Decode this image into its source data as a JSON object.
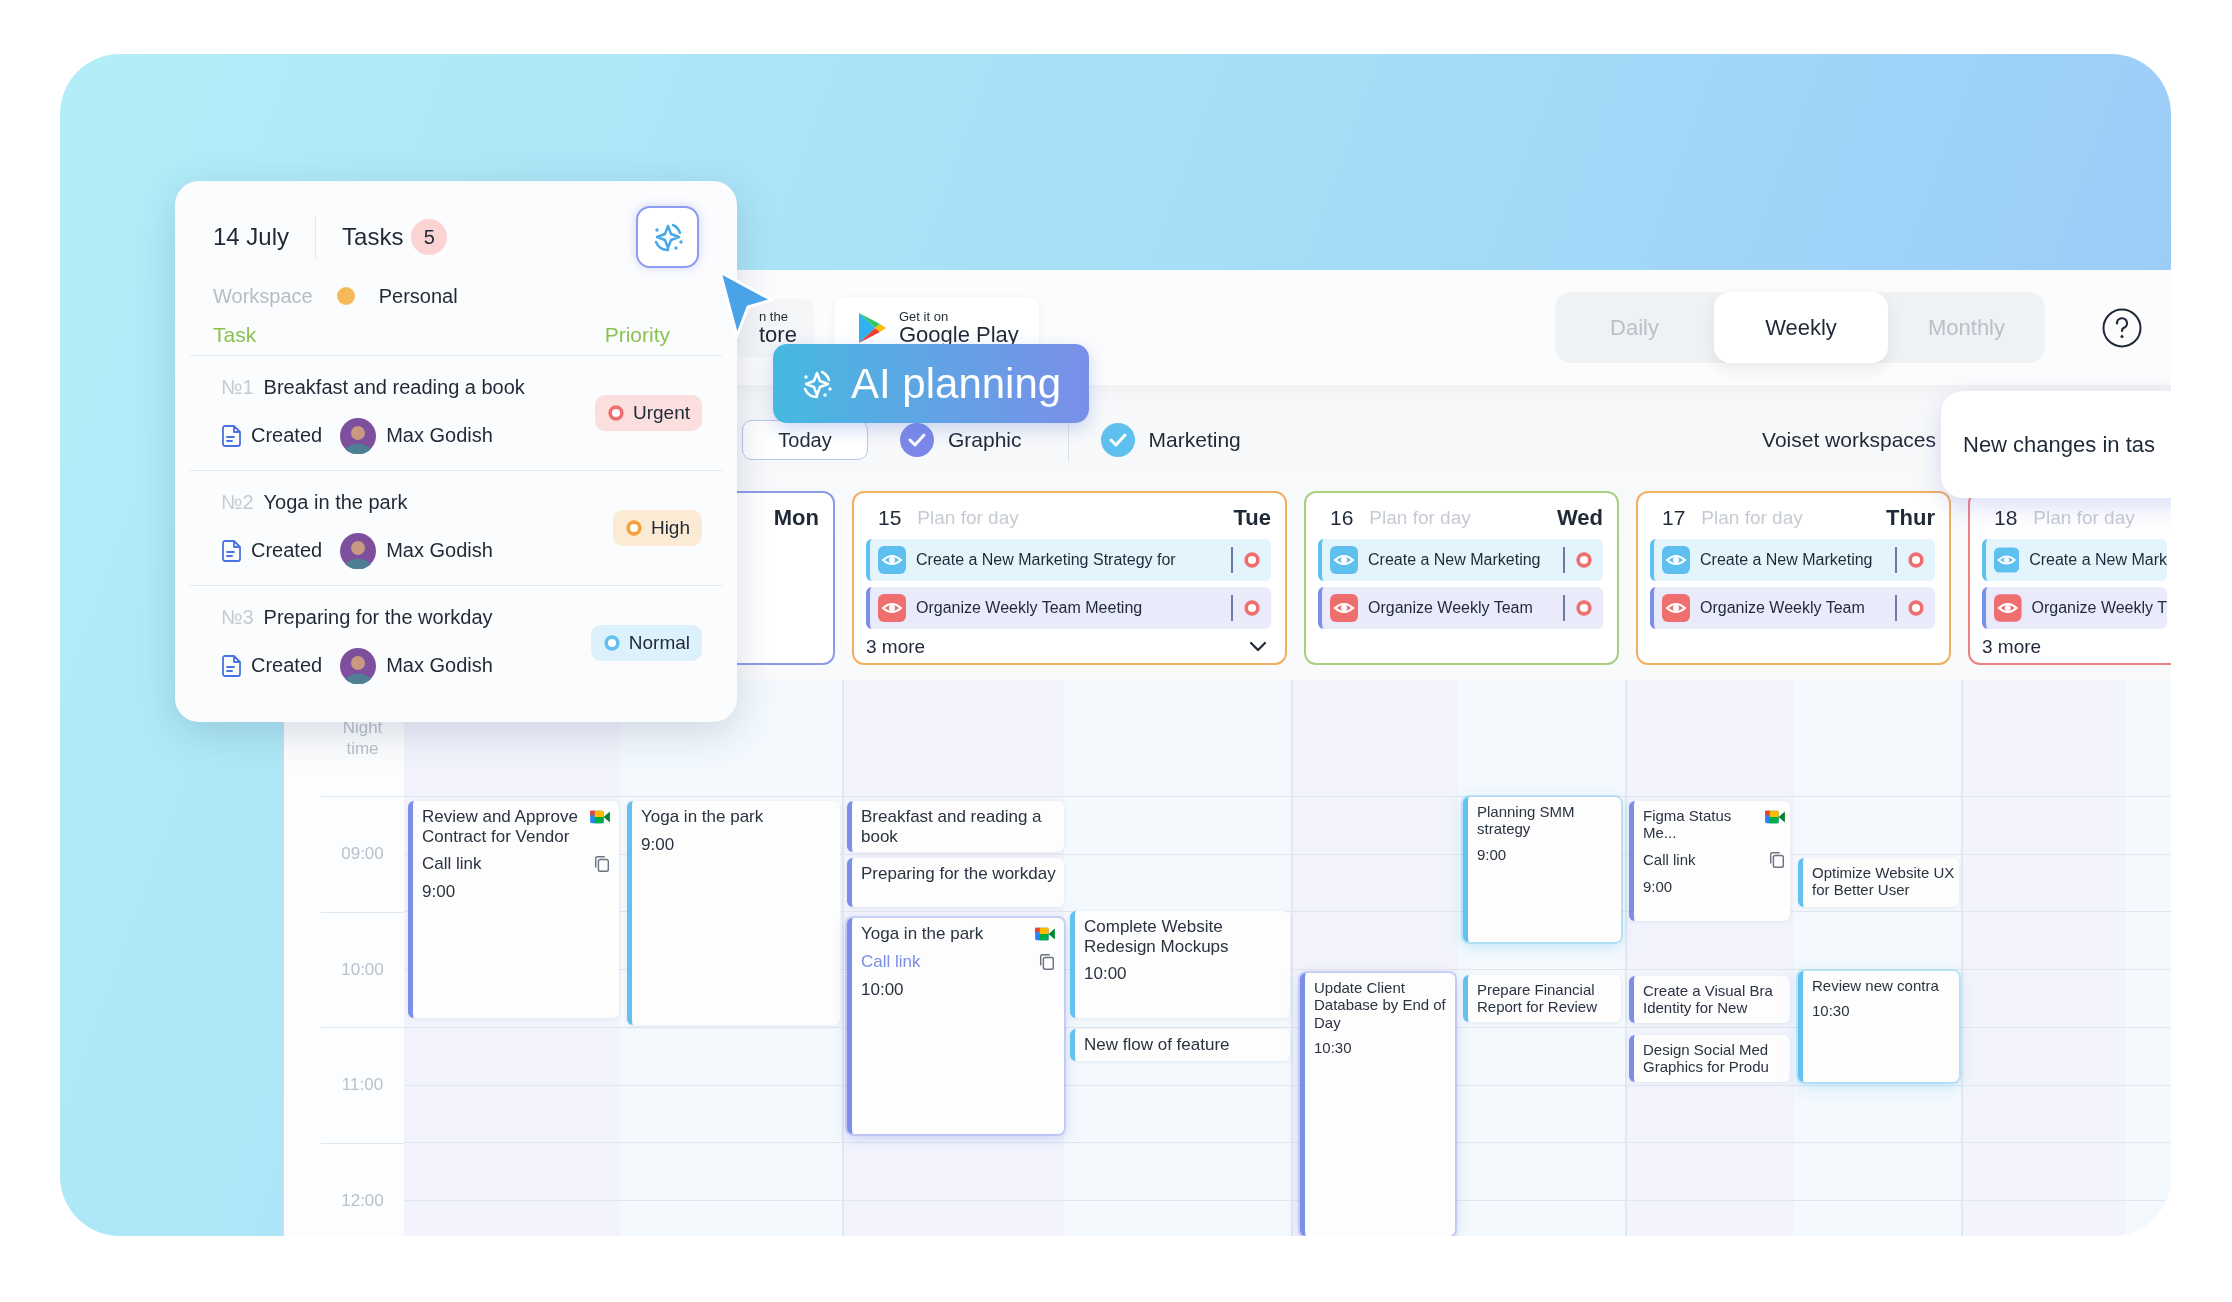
{
  "task_popup": {
    "date": "14 July",
    "tasks_label": "Tasks",
    "task_count": "5",
    "workspace_label": "Workspace",
    "workspace": {
      "name": "Personal",
      "color": "#f5b95a"
    },
    "columns": [
      "Task",
      "Priority"
    ],
    "tasks": [
      {
        "number": "№1",
        "title": "Breakfast and reading a book",
        "status": "Created",
        "assignee": "Max Godish",
        "priority": {
          "label": "Urgent",
          "color": "#ee6f6f"
        }
      },
      {
        "number": "№2",
        "title": "Yoga in the park",
        "status": "Created",
        "assignee": "Max Godish",
        "priority": {
          "label": "High",
          "color": "#f3a23c"
        }
      },
      {
        "number": "№3",
        "title": "Preparing for the workday",
        "status": "Created",
        "assignee": "Max Godish",
        "priority": {
          "label": "Normal",
          "color": "#62c1ee"
        }
      }
    ]
  },
  "top_bar": {
    "store_badges": [
      {
        "kind": "text",
        "line_1": "n the",
        "line_2": "tore"
      },
      {
        "kind": "google_play",
        "line_1": "Get it on",
        "line_2": "Google Play"
      }
    ],
    "views": [
      {
        "label": "Daily",
        "selected": false
      },
      {
        "label": "Weekly",
        "selected": true
      },
      {
        "label": "Monthly",
        "selected": false
      }
    ]
  },
  "ai_banner": {
    "label": "AI planning"
  },
  "filters": {
    "today": "Today",
    "workspaces": [
      {
        "label": "Graphic",
        "checked": true,
        "color": "#7b88e8"
      },
      {
        "label": "Marketing",
        "checked": true,
        "color": "#5ec0ef"
      }
    ],
    "workspaces_label": "Voiset workspaces"
  },
  "notification": {
    "text": "New changes in tas"
  },
  "days": [
    {
      "day": "Mon",
      "color": "#8c9be8"
    },
    {
      "number": "15",
      "plan_label": "Plan for day",
      "day": "Tue",
      "color": "#f0b060",
      "tasks": [
        {
          "title": "Create a New Marketing Strategy for",
          "kind": "info",
          "flagged": true
        },
        {
          "title": "Organize Weekly Team Meeting",
          "kind": "alert",
          "flagged": true
        }
      ],
      "more": "3 more",
      "expandable": true
    },
    {
      "number": "16",
      "plan_label": "Plan for day",
      "day": "Wed",
      "color": "#a8d080",
      "tasks": [
        {
          "title": "Create a New Marketing",
          "kind": "info",
          "flagged": true
        },
        {
          "title": "Organize Weekly Team",
          "kind": "alert",
          "flagged": true
        }
      ]
    },
    {
      "number": "17",
      "plan_label": "Plan for day",
      "day": "Thur",
      "color": "#f0b060",
      "tasks": [
        {
          "title": "Create a New Marketing",
          "kind": "info",
          "flagged": true
        },
        {
          "title": "Organize Weekly Team",
          "kind": "alert",
          "flagged": true
        }
      ]
    },
    {
      "number": "18",
      "plan_label": "Plan for day",
      "color": "#f08080",
      "tasks": [
        {
          "title": "Create a New Mark",
          "kind": "info",
          "flagged": false
        },
        {
          "title": "Organize Weekly T",
          "kind": "alert",
          "flagged": false
        }
      ],
      "more": "3 more",
      "expandable": false
    }
  ],
  "calendar": {
    "times": [
      "Night time",
      "09:00",
      "10:00",
      "11:00",
      "12:00"
    ],
    "events": [
      {
        "title": "Review and Approve Contract for Vendor",
        "meet": true,
        "call_link": "Call link",
        "time": "9:00",
        "color": "#7b8ee8",
        "highlighted": false
      },
      {
        "title": "Yoga in the park",
        "meet": false,
        "time": "9:00",
        "color": "#62c1ee",
        "highlighted": false
      },
      {
        "title": "Breakfast and reading a book",
        "meet": false,
        "color": "#7b8ee8",
        "highlighted": false
      },
      {
        "title": "Preparing for the workday",
        "meet": false,
        "color": "#7b8ee8",
        "highlighted": false
      },
      {
        "title": "Yoga in the park",
        "meet": true,
        "call_link": "Call link",
        "time": "10:00",
        "color": "#7b8ee8",
        "highlighted": true
      },
      {
        "title": "Complete Website Redesign Mockups",
        "meet": false,
        "time": "10:00",
        "color": "#62c1ee",
        "highlighted": false
      },
      {
        "title": "New flow of feature",
        "meet": false,
        "color": "#62c1ee",
        "highlighted": false
      },
      {
        "title": "Update Client Database by End of Day",
        "meet": false,
        "time": "10:30",
        "color": "#7b8ee8",
        "highlighted": true
      },
      {
        "title": "Planning SMM strategy",
        "meet": false,
        "time": "9:00",
        "color": "#62c1ee",
        "highlighted": true
      },
      {
        "title": "Prepare Financial Report for Review",
        "meet": false,
        "color": "#62c1ee",
        "highlighted": false
      },
      {
        "title": "Figma Status Me...",
        "meet": true,
        "call_link": "Call link",
        "time": "9:00",
        "color": "#7b8ee8",
        "highlighted": false
      },
      {
        "title": "Optimize Website UX for Better User",
        "meet": false,
        "color": "#62c1ee",
        "highlighted": false
      },
      {
        "title": "Create a Visual Bra Identity for New",
        "meet": false,
        "color": "#7b8ee8",
        "highlighted": false
      },
      {
        "title": "Design Social Med Graphics for Produ",
        "meet": false,
        "color": "#7b8ee8",
        "highlighted": false
      },
      {
        "title": "Review new contra",
        "meet": false,
        "time": "10:30",
        "color": "#62c1ee",
        "highlighted": true
      }
    ]
  }
}
